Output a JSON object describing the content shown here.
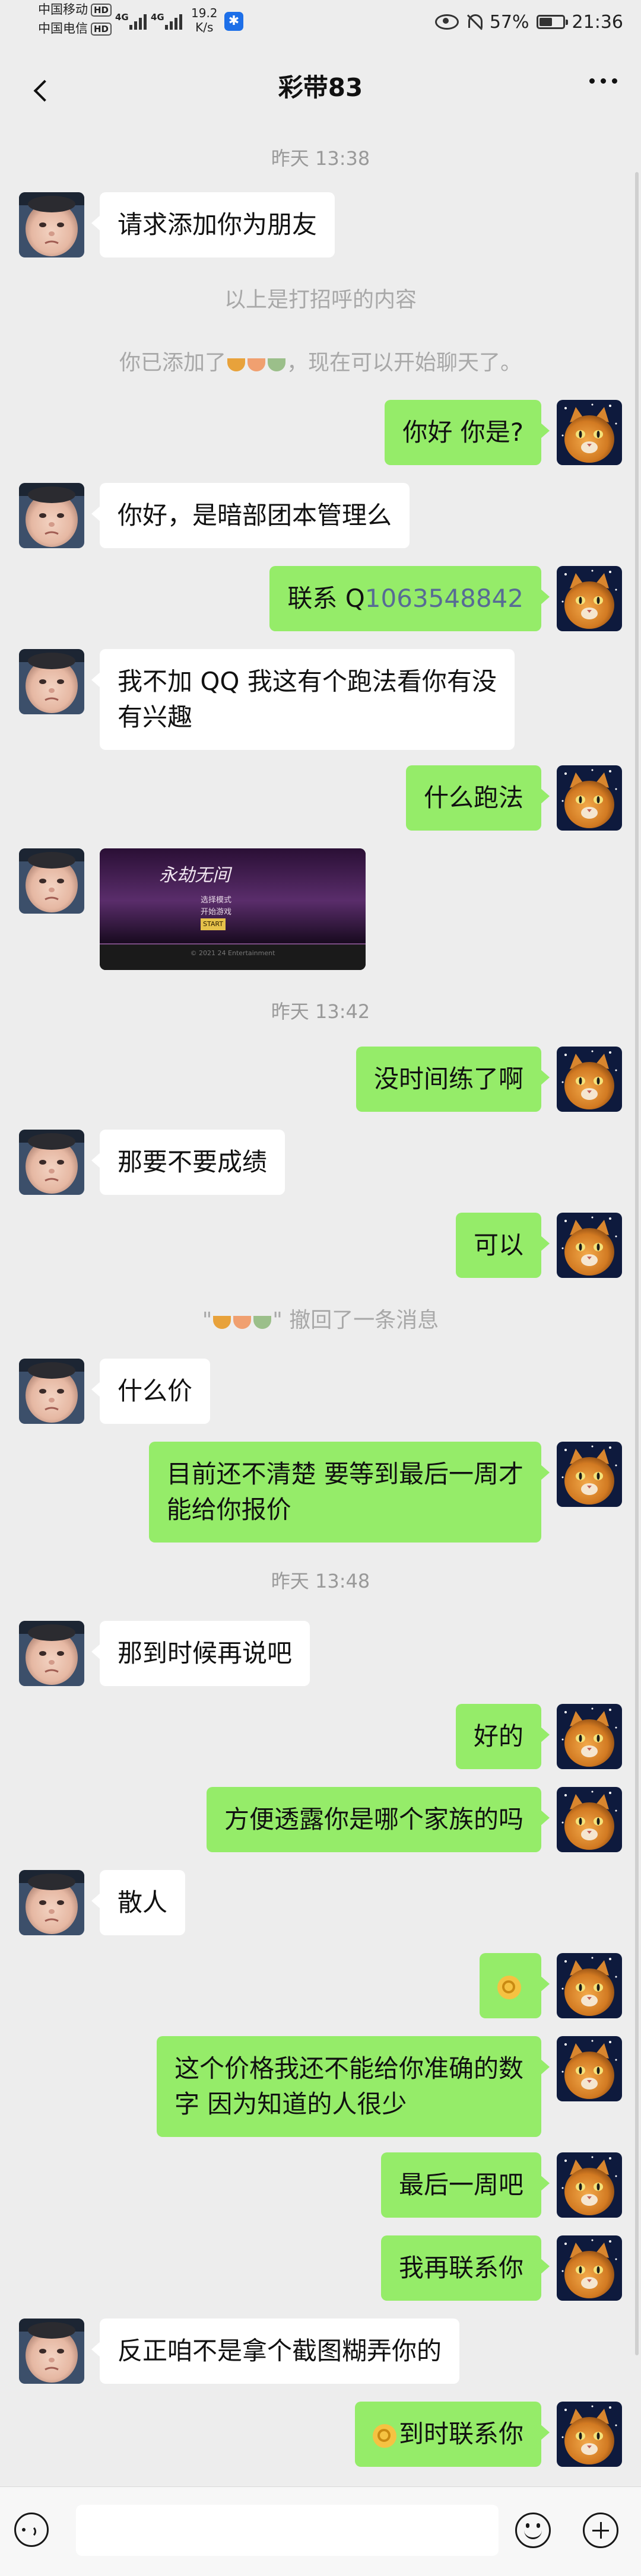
{
  "status_bar": {
    "carrier1": "中国移动",
    "carrier2": "中国电信",
    "hd": "HD",
    "net1": "4G",
    "net2": "4G",
    "speed_value": "19.2",
    "speed_unit": "K/s",
    "battery": "57%",
    "battery_level": 0.57,
    "time": "21:36"
  },
  "nav": {
    "title": "彩带83"
  },
  "messages": {
    "ts1": "昨天 13:38",
    "m1": "请求添加你为朋友",
    "sys1": "以上是打招呼的内容",
    "sys2_pre": "你已添加了",
    "sys2_post": "，现在可以开始聊天了。",
    "m2": "你好 你是?",
    "m3": "你好，是暗部团本管理么",
    "m4_pre": "联系 Q",
    "m4_qq": "1063548842",
    "m5_line1": "我不加 QQ 我这有个跑法看你有没",
    "m5_line2": "有兴趣",
    "m6": "什么跑法",
    "ts2": "昨天 13:42",
    "m8": "没时间练了啊",
    "m9": "那要不要成绩",
    "m10": "可以",
    "sys3_open": "\"",
    "sys3_close": "\" 撤回了一条消息",
    "m11": "什么价",
    "m12_line1": "目前还不清楚 要等到最后一周才",
    "m12_line2": "能给你报价",
    "ts3": "昨天 13:48",
    "m13": "那到时候再说吧",
    "m14": "好的",
    "m15": "方便透露你是哪个家族的吗",
    "m16": "散人",
    "m18_line1": "这个价格我还不能给你准确的数",
    "m18_line2": "字 因为知道的人很少",
    "m19": "最后一周吧",
    "m20": "我再联系你",
    "m21": "反正咱不是拿个截图糊弄你的",
    "m22": "到时联系你"
  },
  "image_message": {
    "logo": "永劫无间",
    "menu1": "选择模式",
    "menu2": "开始游戏",
    "start": "START",
    "footer": "© 2021 24 Entertainment"
  },
  "input_bar": {
    "placeholder": ""
  },
  "colors": {
    "bubble_self": "#95ec69",
    "bubble_other": "#ffffff",
    "background": "#ededed",
    "qq_link": "#576b95"
  },
  "icons": [
    "back-icon",
    "more-icon",
    "voice-icon",
    "emoji-icon",
    "plus-icon",
    "ok-hand-icon",
    "avatar-baby",
    "avatar-cat"
  ]
}
